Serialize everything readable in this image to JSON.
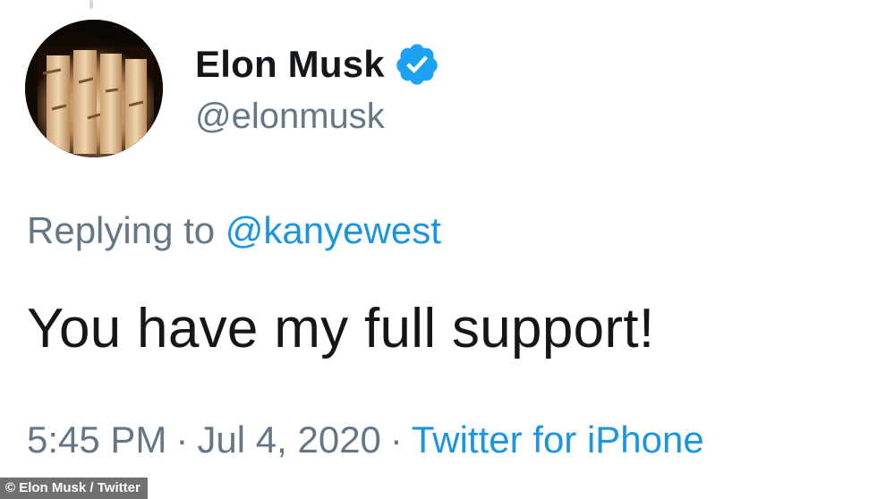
{
  "tweet": {
    "author": {
      "display_name": "Elon Musk",
      "handle": "@elonmusk",
      "verified": true,
      "avatar_icon": "burnt-wood-avatar"
    },
    "reply": {
      "prefix": "Replying to",
      "target": "@kanyewest"
    },
    "text": "You have my full support!",
    "meta": {
      "time": "5:45 PM",
      "separator": "·",
      "date": "Jul 4, 2020",
      "source": "Twitter for iPhone"
    }
  },
  "credit": "© Elon Musk / Twitter",
  "colors": {
    "text": "#14171a",
    "secondary": "#657786",
    "link": "#1b95e0",
    "verified": "#1da1f2"
  }
}
